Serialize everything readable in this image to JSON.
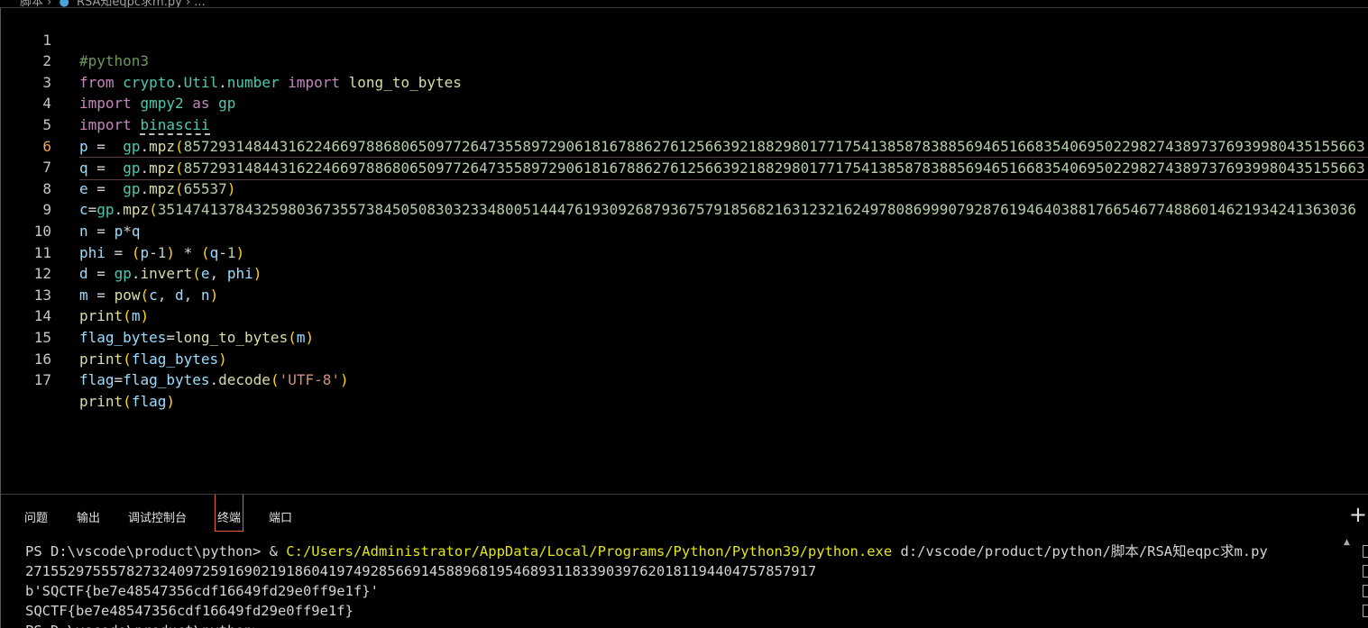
{
  "breadcrumb": {
    "folder": "脚本",
    "sep1": "›",
    "file": "RSA知eqpc求m.py",
    "sep2": "›",
    "more": "..."
  },
  "editor": {
    "lines": [
      {
        "n": "1"
      },
      {
        "n": "2"
      },
      {
        "n": "3"
      },
      {
        "n": "4"
      },
      {
        "n": "5"
      },
      {
        "n": "6"
      },
      {
        "n": "7"
      },
      {
        "n": "8"
      },
      {
        "n": "9"
      },
      {
        "n": "10"
      },
      {
        "n": "11"
      },
      {
        "n": "12"
      },
      {
        "n": "13"
      },
      {
        "n": "14"
      },
      {
        "n": "15"
      },
      {
        "n": "16"
      },
      {
        "n": "17"
      }
    ],
    "p_value": "8572931484431622466978868065097726473558972906181678862761256639218829801771754138587838856946516683540695022982743897376939980435155663",
    "q_value": "8572931484431622466978868065097726473558972906181678862761256639218829801771754138587838856946516683540695022982743897376939980435155663",
    "e_value": "65537",
    "c_value": "351474137843259803673557384505083032334800514447619309268793675791856821631232162497808699907928761946403881766546774886014621934241363036"
  },
  "panel": {
    "tabs": [
      {
        "label": "问题"
      },
      {
        "label": "输出"
      },
      {
        "label": "调试控制台"
      },
      {
        "label": "终端"
      },
      {
        "label": "端口"
      }
    ],
    "plus": "+"
  },
  "terminal": {
    "prompt": "PS D:\\vscode\\product\\python> & ",
    "exe": "C:/Users/Administrator/AppData/Local/Programs/Python/Python39/python.exe",
    "script": " d:/vscode/product/python/脚本/RSA知eqpc求m.py",
    "out1": "27155297555782732409725916902191860419749285669145889681954689311833903976201811944047578579​17",
    "out2": "b'SQCTF{be7e48547356cdf16649fd29e0ff9e1f}'",
    "out3": "SQCTF{be7e48547356cdf16649fd29e0ff9e1f}",
    "out4": "PS D:\\vscode\\product\\python>"
  }
}
